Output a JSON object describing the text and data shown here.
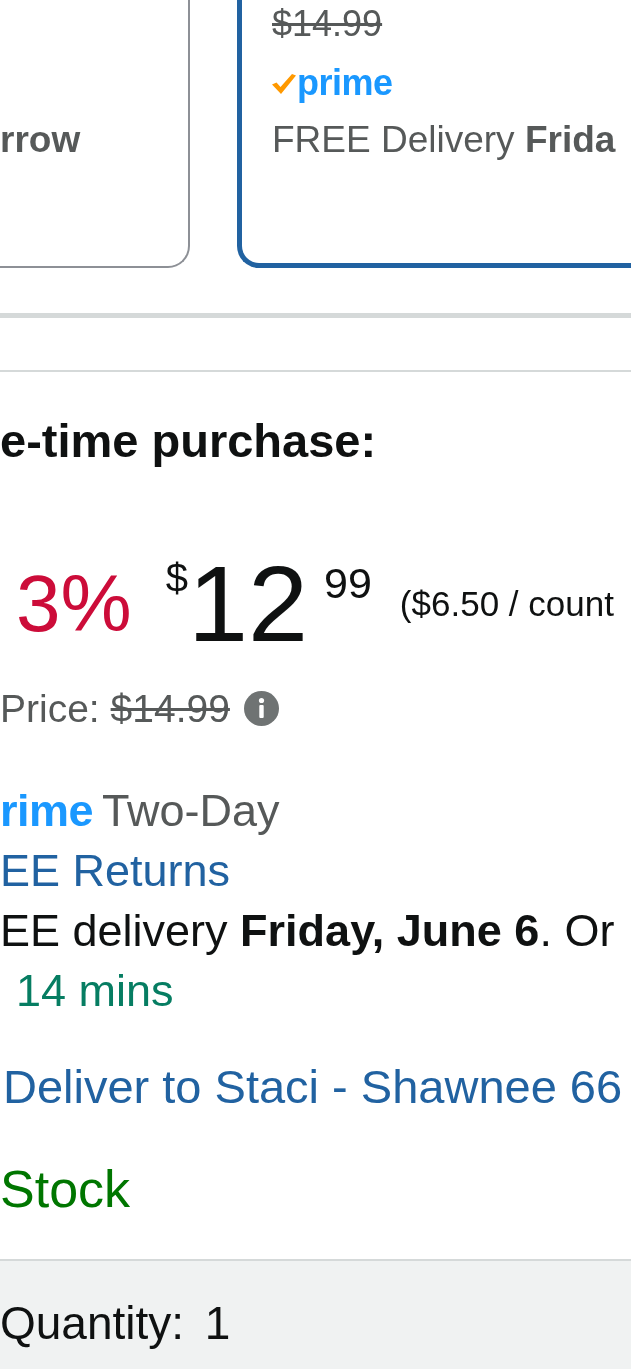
{
  "purchase_options": [
    {
      "kind": "summary",
      "label": "rrow",
      "selected": false
    },
    {
      "kind": "detail",
      "strike_price": "$14.99",
      "badge": "prime",
      "delivery": "FREE Delivery **Frida**",
      "selected": true
    }
  ],
  "one_time_purchase": {
    "heading": "e-time purchase:",
    "discount": "3%",
    "price": {
      "symbol": "$",
      "whole": "12",
      "fraction": "99"
    },
    "unit_price": "($6.50 / count",
    "list_price": {
      "label": "Price:",
      "value": "$14.99"
    },
    "badge": "rime",
    "shipping_speed": "Two-Day",
    "returns_link": "EE Returns",
    "delivery": "EE delivery **Friday, June 6**. Or",
    "countdown": "14 mins",
    "deliver_to": "Deliver to Staci - Shawnee 66",
    "stock": "Stock",
    "quantity": {
      "label": "Quantity:",
      "value": "1"
    }
  }
}
